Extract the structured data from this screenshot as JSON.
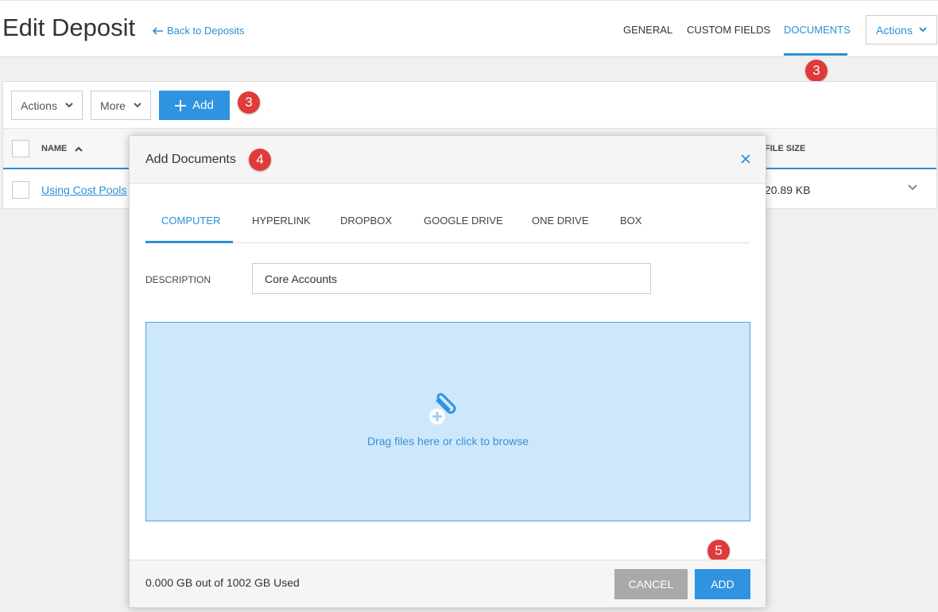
{
  "header": {
    "title": "Edit Deposit",
    "back_link": "Back to Deposits",
    "tabs": [
      "GENERAL",
      "CUSTOM FIELDS",
      "DOCUMENTS"
    ],
    "active_tab": "DOCUMENTS",
    "actions_label": "Actions"
  },
  "badges": [
    "3",
    "3",
    "4",
    "5"
  ],
  "toolbar": {
    "actions_label": "Actions",
    "more_label": "More",
    "add_label": "Add"
  },
  "table": {
    "columns": [
      "NAME",
      "FILE SIZE"
    ],
    "rows": [
      {
        "name": "Using Cost Pools",
        "size": "20.89 KB"
      }
    ]
  },
  "modal": {
    "title": "Add Documents",
    "tabs": [
      "COMPUTER",
      "HYPERLINK",
      "DROPBOX",
      "GOOGLE DRIVE",
      "ONE DRIVE",
      "BOX"
    ],
    "active_tab": "COMPUTER",
    "description_label": "DESCRIPTION",
    "description_value": "Core Accounts",
    "dropzone_text": "Drag files here or click to browse",
    "usage_text": "0.000 GB out of 1002 GB Used",
    "cancel_label": "CANCEL",
    "add_label": "ADD"
  },
  "colors": {
    "accent": "#2a8fd8",
    "badge": "#e03b3b",
    "dropzone_bg": "#cde8fc"
  },
  "icons": [
    "left-arrow-icon",
    "chevron-down-icon",
    "plus-icon",
    "sort-up-icon",
    "close-icon",
    "paperclip-plus-icon"
  ]
}
